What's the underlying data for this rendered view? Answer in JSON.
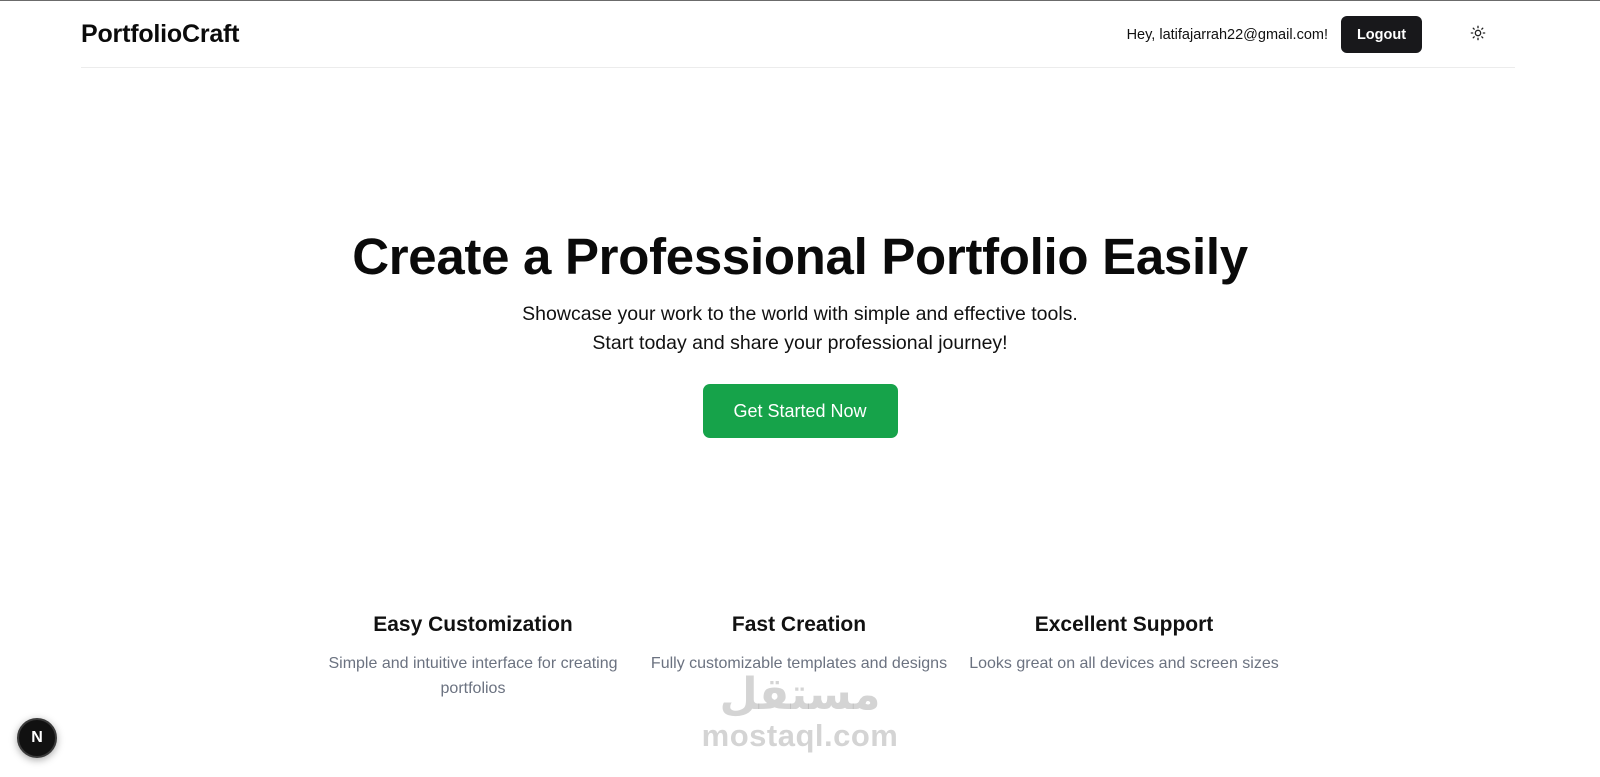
{
  "header": {
    "brand": "PortfolioCraft",
    "greeting": "Hey, latifajarrah22@gmail.com!",
    "logout_label": "Logout",
    "theme_icon": "sun-icon"
  },
  "hero": {
    "title": "Create a Professional Portfolio Easily",
    "subtitle": "Showcase your work to the world with simple and effective tools. Start today and share your professional journey!",
    "cta_label": "Get Started Now",
    "cta_color": "#16a34a"
  },
  "features": [
    {
      "title": "Easy Customization",
      "description": "Simple and intuitive interface for creating portfolios"
    },
    {
      "title": "Fast Creation",
      "description": "Fully customizable templates and designs"
    },
    {
      "title": "Excellent Support",
      "description": "Looks great on all devices and screen sizes"
    }
  ],
  "watermark": {
    "arabic": "مستقل",
    "latin": "mostaql.com"
  },
  "dev_badge": {
    "label": "N"
  }
}
